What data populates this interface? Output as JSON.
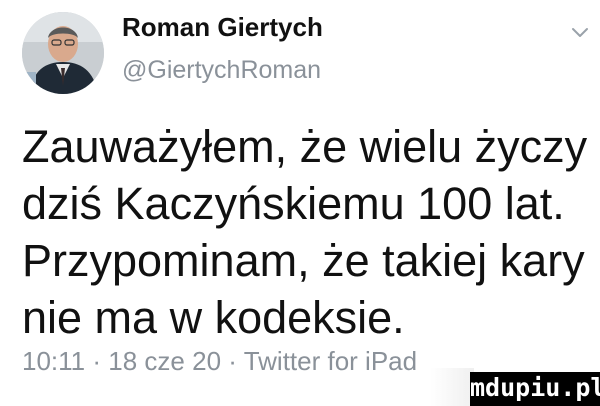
{
  "tweet": {
    "author": {
      "display_name": "Roman Giertych",
      "handle": "@GiertychRoman",
      "avatar_icon": "profile-photo"
    },
    "menu_icon": "chevron-down-icon",
    "text_lines": [
      "Zauważyłem, że wielu życzy",
      "dziś Kaczyńskiemu 100 lat.",
      "Przypominam, że takiej kary",
      "nie ma w kodeksie."
    ],
    "meta": {
      "time": "10:11",
      "separator": "·",
      "date": "18 cze 20",
      "source": "Twitter for iPad"
    }
  },
  "watermark": {
    "text": "mdupiu.pl"
  },
  "colors": {
    "text": "#111111",
    "secondary": "#8a9199",
    "background": "#ffffff",
    "watermark_bg": "#000000"
  }
}
